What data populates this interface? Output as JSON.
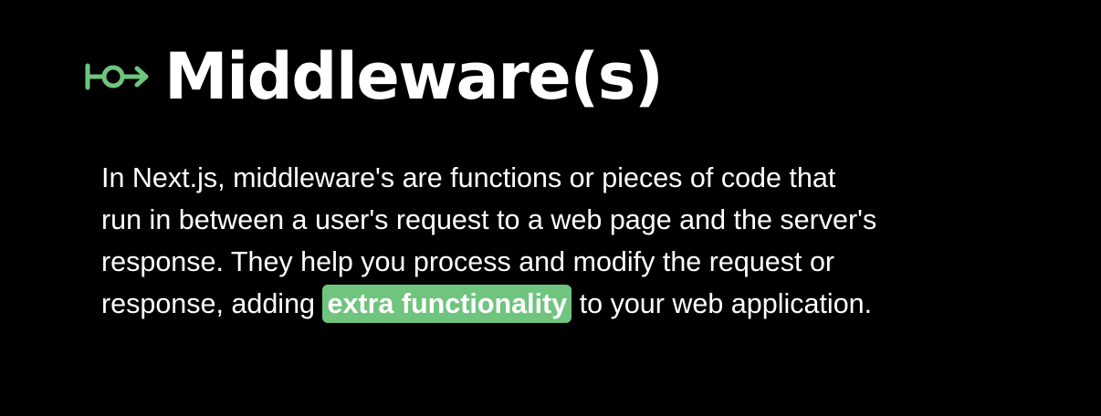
{
  "slide": {
    "title": "Middleware(s)",
    "title_icon": "git-commit-arrow-icon",
    "accent_color": "#6fc47e",
    "body_lines": [
      "In Next.js, middleware's are functions or pieces of code that",
      "run in between a user's request to a web page and the server's",
      "response. They help you process and modify the request or"
    ],
    "last_line_before": "response, adding ",
    "highlight_text": "extra functionality",
    "last_line_after": " to your web application."
  }
}
